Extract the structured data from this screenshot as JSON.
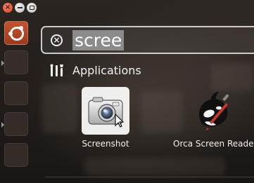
{
  "window_controls": {
    "close": "close-icon",
    "minimize": "minimize-icon",
    "maximize": "maximize-icon"
  },
  "launcher": {
    "bfb_icon": "ubuntu-logo-icon"
  },
  "search": {
    "clear_icon": "clear-search-icon",
    "query": "scree"
  },
  "category": {
    "icon": "applications-icon",
    "label": "Applications"
  },
  "results": [
    {
      "label": "Screenshot",
      "icon": "camera-icon",
      "selected": true
    },
    {
      "label": "Orca Screen Reader",
      "icon": "orca-whale-icon",
      "selected": false
    }
  ],
  "colors": {
    "launcher_accent": "#c2532f",
    "close_button": "#d8431f",
    "selection_highlight": "#8b8b8b"
  }
}
